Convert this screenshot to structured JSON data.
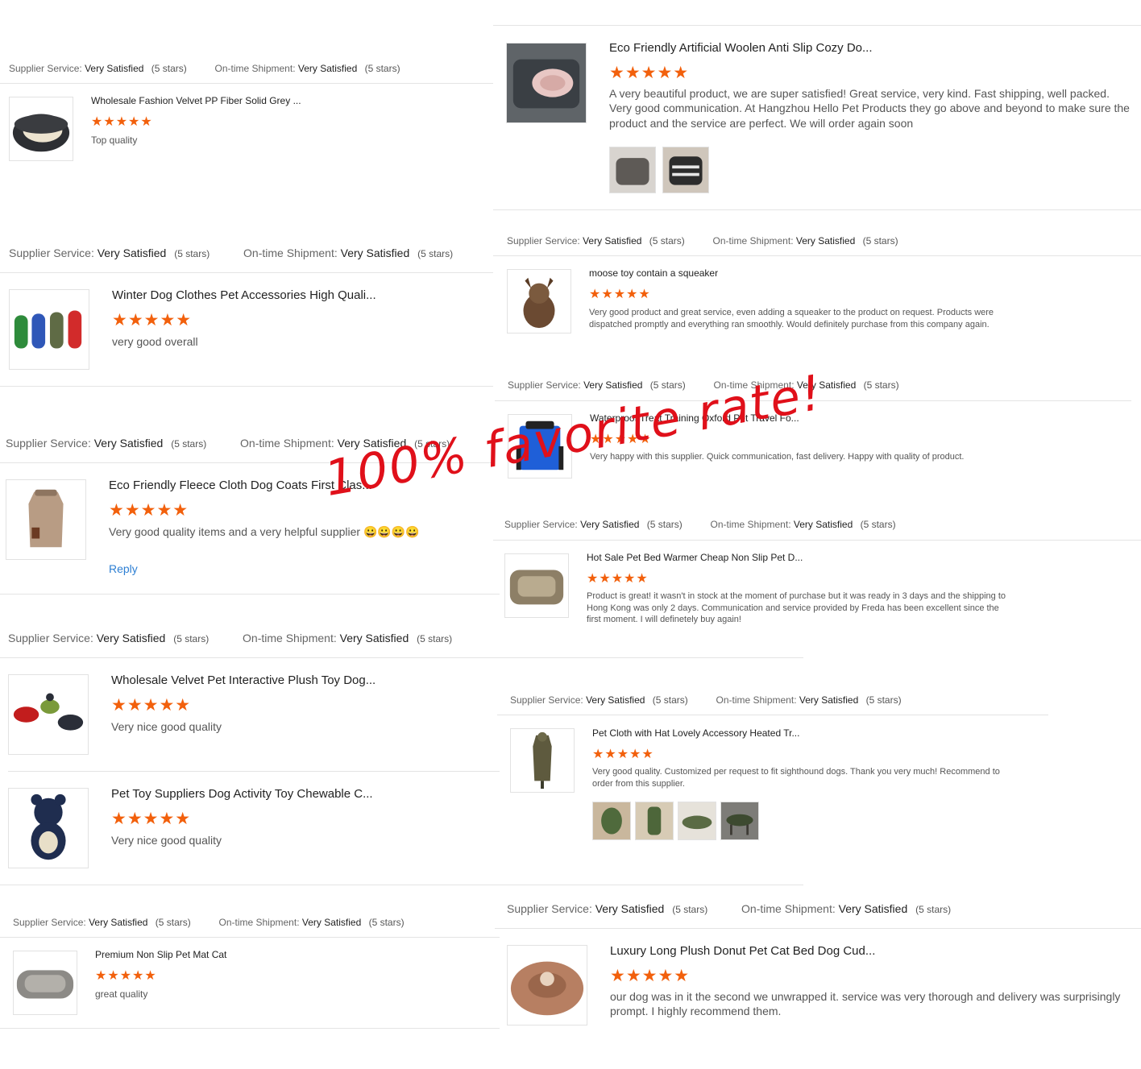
{
  "colors": {
    "star": "#f2600c",
    "overlay": "#e0101a",
    "link": "#2d7fd3"
  },
  "labels": {
    "supplier_service": "Supplier Service:",
    "ontime_shipment": "On-time Shipment:",
    "very_satisfied": "Very Satisfied",
    "five_stars": "(5 stars)"
  },
  "star_glyphs": "★★★★★",
  "overlay": "100% favorite rate!",
  "reviews": [
    {
      "title": "Wholesale Fashion Velvet PP Fiber Solid Grey ...",
      "rating": 5,
      "text": "Top quality",
      "icon": "pet-bed-icon"
    },
    {
      "title": "Winter Dog Clothes Pet Accessories High Quali...",
      "rating": 5,
      "text": "very good overall",
      "icon": "dog-coats-icon"
    },
    {
      "title": "Eco Friendly Fleece Cloth Dog Coats First Clas...",
      "rating": 5,
      "text": "Very good quality items and a very helpful supplier 😀😀😀😀",
      "reply": "Reply",
      "icon": "dog-coat-icon"
    },
    {
      "title": "Wholesale Velvet Pet Interactive Plush Toy Dog...",
      "rating": 5,
      "text": "Very nice good quality",
      "icon": "plush-toys-icon"
    },
    {
      "title": "Pet Toy Suppliers Dog Activity Toy Chewable C...",
      "rating": 5,
      "text": "Very nice good quality",
      "icon": "plush-bear-icon"
    },
    {
      "title": "Premium Non Slip Pet Mat Cat",
      "rating": 5,
      "text": "great quality",
      "icon": "pet-mat-icon"
    },
    {
      "title": "Eco Friendly Artificial Woolen Anti Slip Cozy Do...",
      "rating": 5,
      "text": "A very beautiful product, we are super satisfied! Great service, very kind. Fast shipping, well packed. Very good communication. At Hangzhou Hello Pet Products they go above and beyond to make sure the product and the service are perfect. We will order again soon",
      "icon": "car-seat-bed-icon"
    },
    {
      "title": "moose toy contain a squeaker",
      "rating": 5,
      "text": "Very good product and great service, even adding a squeaker to the product on request. Products were dispatched promptly and everything ran smoothly. Would definitely purchase from this company again.",
      "icon": "moose-toy-icon"
    },
    {
      "title": "Waterproof Treat Training Oxford Pet Travel Fo...",
      "rating": 5,
      "text": "Very happy with this supplier. Quick communication, fast delivery. Happy with quality of product.",
      "icon": "treat-bag-icon"
    },
    {
      "title": "Hot Sale Pet Bed Warmer Cheap Non Slip Pet D...",
      "rating": 5,
      "text": "Product is great! it wasn't in stock at the moment of purchase but it was ready in 3 days and the shipping to Hong Kong was only 2 days. Communication and service provided by Freda has been excellent since the first moment. I will definetely buy again!",
      "icon": "square-bed-icon"
    },
    {
      "title": "Pet Cloth with Hat Lovely Accessory Heated Tr...",
      "rating": 5,
      "text": "Very good quality. Customized per request to fit sighthound dogs. Thank you very much! Recommend to order from this supplier.",
      "icon": "hooded-coat-icon"
    },
    {
      "title": "Luxury Long Plush Donut Pet Cat Bed Dog Cud...",
      "rating": 5,
      "text": "our dog was in it the second we unwrapped it. service was very thorough and delivery was surprisingly prompt. I highly recommend them.",
      "icon": "donut-bed-icon"
    }
  ]
}
